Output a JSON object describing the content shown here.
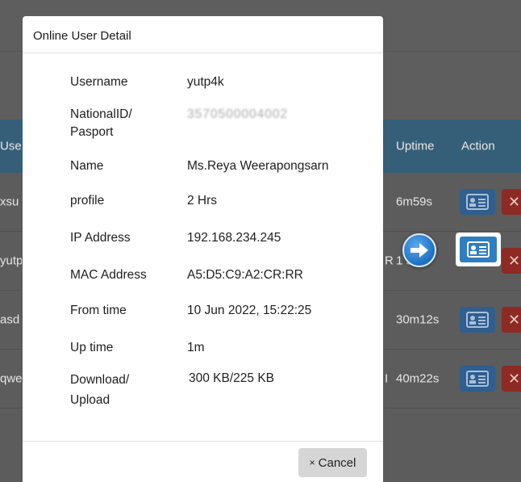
{
  "background_table": {
    "headers": {
      "user": "Use",
      "uptime": "Uptime",
      "action": "Action"
    },
    "rows": [
      {
        "user": "xsu",
        "edge": "",
        "uptime": "6m59s"
      },
      {
        "user": "yutp",
        "edge": "R",
        "uptime": "1  s"
      },
      {
        "user": "asd",
        "edge": "",
        "uptime": "30m12s"
      },
      {
        "user": "qwe",
        "edge": "I",
        "uptime": "40m22s"
      }
    ]
  },
  "modal": {
    "title": "Online User Detail",
    "fields": [
      {
        "label": "Username",
        "value": "yutp4k"
      },
      {
        "label": "NationalID/\nPasport",
        "value": "3570500004002"
      },
      {
        "label": "Name",
        "value": "Ms.Reya Weerapongsarn"
      },
      {
        "label": "profile",
        "value": "2 Hrs"
      },
      {
        "label": "IP Address",
        "value": "192.168.234.245"
      },
      {
        "label": "MAC Address",
        "value": "A5:D5:C9:A2:CR:RR"
      },
      {
        "label": "From time",
        "value": "10 Jun 2022, 15:22:25"
      },
      {
        "label": "Up time",
        "value": "1m"
      },
      {
        "label": "Download/\nUpload",
        "value": "300 KB/225 KB"
      }
    ],
    "cancel_icon": "×",
    "cancel_label": "Cancel"
  },
  "icons": {
    "detail_button": "id-card-icon",
    "delete_button": "close-icon",
    "pointer": "arrow-right-icon"
  },
  "colors": {
    "table_header": "#355f78",
    "action_button": "#2f5e8f",
    "action_button_highlight": "#2f7ec2",
    "delete_button": "#8d2a24",
    "pointer": "#1f6fc2"
  }
}
